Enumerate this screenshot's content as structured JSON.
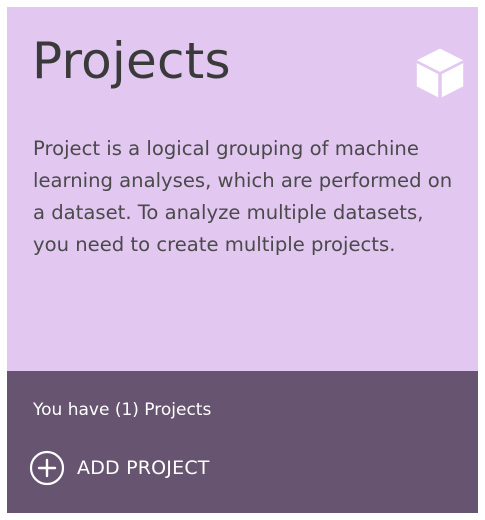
{
  "card": {
    "title": "Projects",
    "title_icon": "cube-icon",
    "description": "Project is a logical grouping of machine learning analyses, which are performed on a dataset. To analyze multiple datasets, you need to create multiple projects.",
    "project_count_text": "You have (1) Projects",
    "add_project": {
      "label": "ADD PROJECT",
      "icon": "plus-circle-icon"
    }
  },
  "colors": {
    "top_background": "#e2c7f1",
    "bottom_background": "#675470",
    "title_text": "#3a3a3a",
    "body_text": "#4a4a4a",
    "footer_text": "#ffffff"
  }
}
